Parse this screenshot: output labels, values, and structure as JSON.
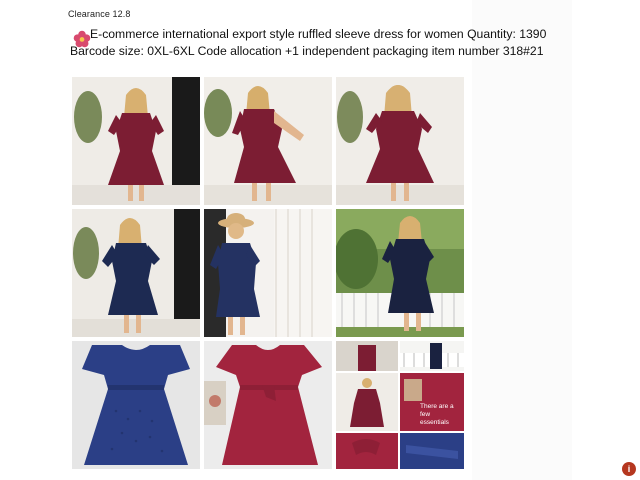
{
  "header": {
    "clearance": "Clearance 12.8",
    "line1": "E-commerce international export style ruffled sleeve dress for women Quantity: 1390",
    "line2": "Barcode size: 0XL-6XL Code allocation +1 independent packaging item number 318#21"
  },
  "overlay": {
    "caption": "There are a few essentials"
  },
  "colors": {
    "burgundy": "#7c1d33",
    "navy": "#1d2a52",
    "royal_blue": "#2b3f86",
    "rose_red": "#a2243e",
    "accent_pink": "#d84a6e",
    "corner_logo": "#b5371f"
  },
  "icons": {
    "flower": "flower-icon",
    "corner": "logo-icon"
  }
}
